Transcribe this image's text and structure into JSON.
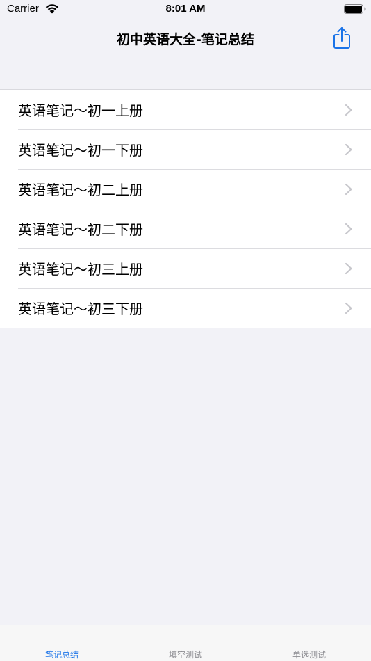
{
  "status_bar": {
    "carrier": "Carrier",
    "time": "8:01 AM"
  },
  "nav": {
    "title": "初中英语大全-笔记总结",
    "share_icon": "share-icon"
  },
  "list": {
    "items": [
      {
        "label": "英语笔记～初一上册"
      },
      {
        "label": "英语笔记～初一下册"
      },
      {
        "label": "英语笔记～初二上册"
      },
      {
        "label": "英语笔记～初二下册"
      },
      {
        "label": "英语笔记～初三上册"
      },
      {
        "label": "英语笔记～初三下册"
      }
    ]
  },
  "tab_bar": {
    "tabs": [
      {
        "label": "笔记总结",
        "active": true
      },
      {
        "label": "填空测试",
        "active": false
      },
      {
        "label": "单选测试",
        "active": false
      }
    ]
  },
  "colors": {
    "accent": "#1a73e8",
    "background": "#f2f2f7",
    "chevron": "#c7c7cc",
    "inactive_tab": "#8e8e93"
  }
}
